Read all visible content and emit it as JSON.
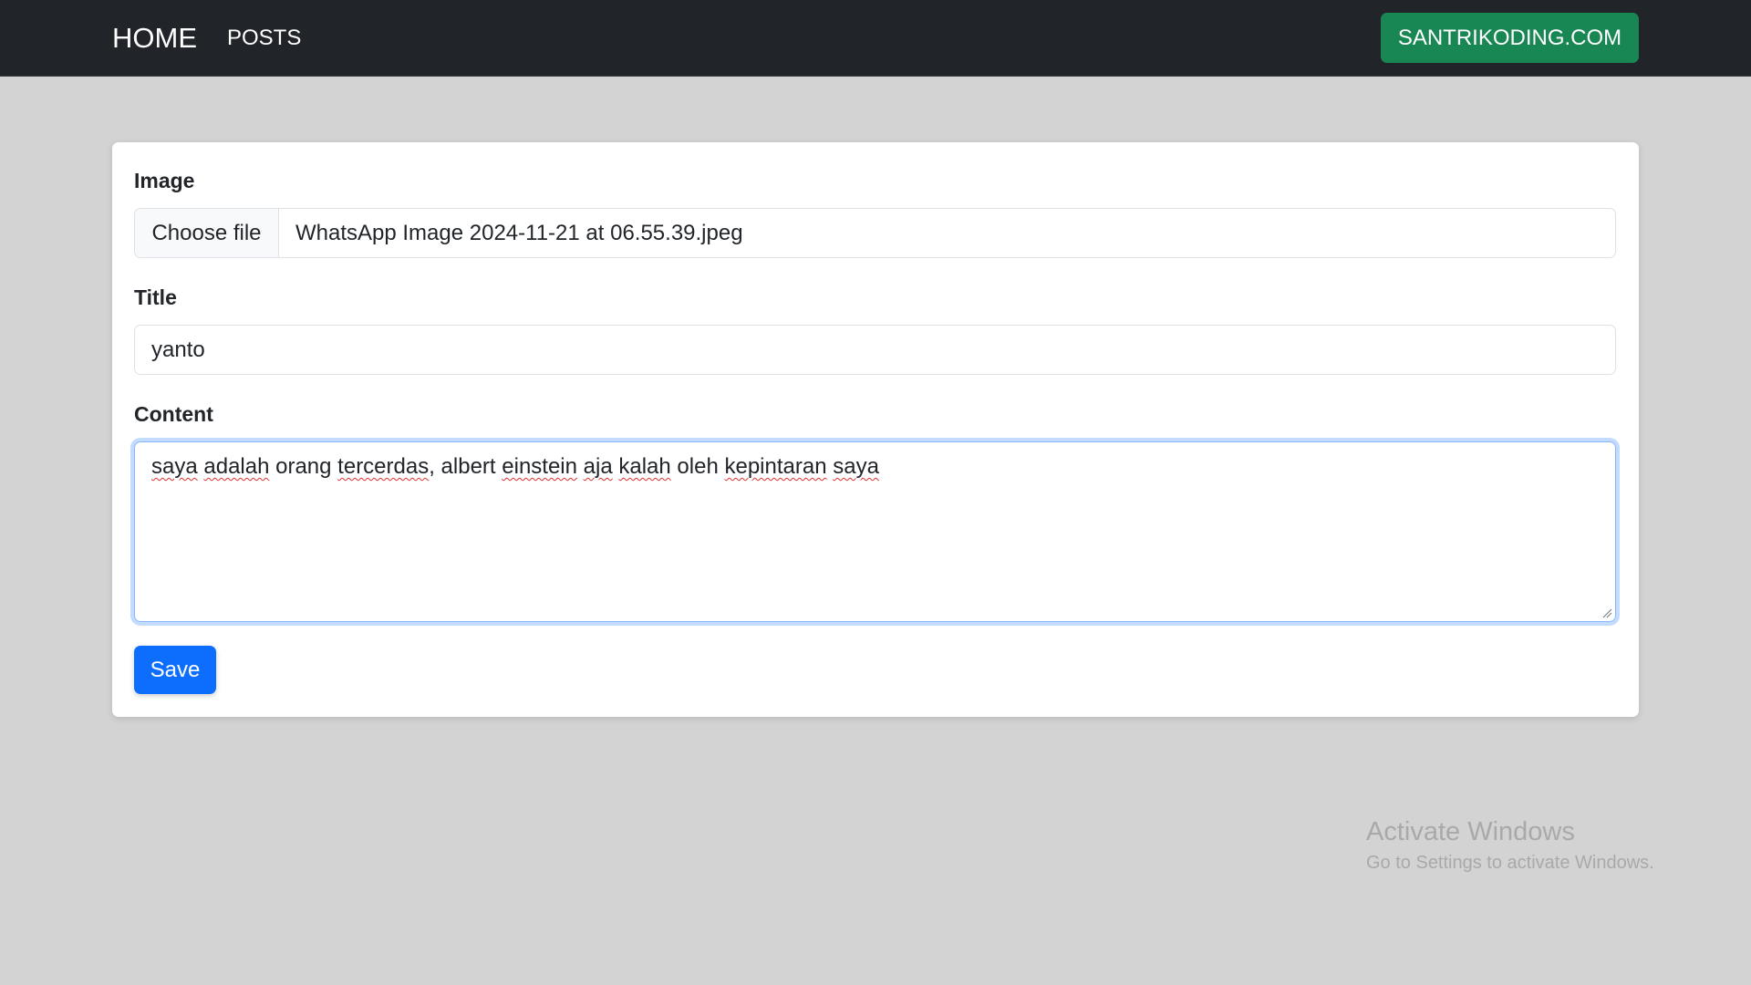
{
  "navbar": {
    "brand": "HOME",
    "links": [
      {
        "label": "POSTS"
      }
    ],
    "site_button": "SANTRIKODING.COM"
  },
  "form": {
    "image": {
      "label": "Image",
      "button": "Choose file",
      "file_name": "WhatsApp Image 2024-11-21 at 06.55.39.jpeg"
    },
    "title": {
      "label": "Title",
      "value": "yanto"
    },
    "content": {
      "label": "Content",
      "words": [
        {
          "text": "saya",
          "spell_error": true
        },
        {
          "text": " ",
          "spell_error": false
        },
        {
          "text": "adalah",
          "spell_error": true
        },
        {
          "text": " orang ",
          "spell_error": false
        },
        {
          "text": "tercerdas",
          "spell_error": true
        },
        {
          "text": ", albert ",
          "spell_error": false
        },
        {
          "text": "einstein",
          "spell_error": true
        },
        {
          "text": " ",
          "spell_error": false
        },
        {
          "text": "aja",
          "spell_error": true
        },
        {
          "text": " ",
          "spell_error": false
        },
        {
          "text": "kalah",
          "spell_error": true
        },
        {
          "text": " oleh ",
          "spell_error": false
        },
        {
          "text": "kepintaran",
          "spell_error": true
        },
        {
          "text": " ",
          "spell_error": false
        },
        {
          "text": "saya",
          "spell_error": true
        }
      ]
    },
    "save_label": "Save"
  },
  "watermark": {
    "title": "Activate Windows",
    "subtitle": "Go to Settings to activate Windows."
  },
  "colors": {
    "navbar_bg": "#212529",
    "page_bg": "#d3d3d3",
    "site_button": "#198754",
    "primary": "#0d6efd",
    "focus_border": "#86b7fe"
  }
}
